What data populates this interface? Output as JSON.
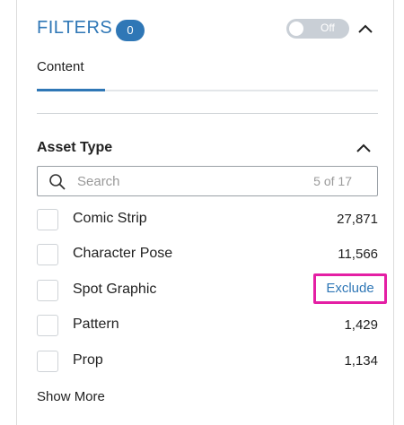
{
  "header": {
    "title": "FILTERS",
    "count": "0",
    "toggle_label": "Off"
  },
  "tabs": [
    {
      "label": "Content",
      "active": true
    }
  ],
  "section": {
    "title": "Asset Type",
    "search": {
      "placeholder": "Search",
      "count": "5 of 17"
    },
    "items": [
      {
        "label": "Comic Strip",
        "count": "27,871"
      },
      {
        "label": "Character Pose",
        "count": "11,566"
      },
      {
        "label": "Spot Graphic",
        "action": "Exclude"
      },
      {
        "label": "Pattern",
        "count": "1,429"
      },
      {
        "label": "Prop",
        "count": "1,134"
      }
    ],
    "show_more": "Show More"
  },
  "colors": {
    "accent": "#2f77b6",
    "highlight": "#e41fa4",
    "toggle_off": "#c9cfd6"
  }
}
